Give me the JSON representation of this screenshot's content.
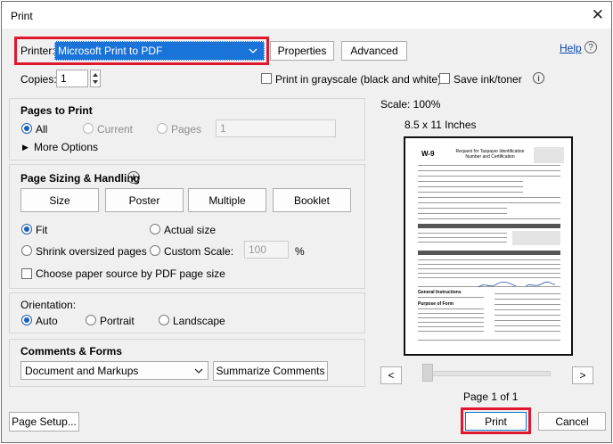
{
  "window": {
    "title": "Print",
    "close_glyph": "✕"
  },
  "printer": {
    "label": "Printer:",
    "selected": "Microsoft Print to PDF",
    "properties_button": "Properties",
    "advanced_button": "Advanced",
    "help_link": "Help",
    "help_icon": "?"
  },
  "copies": {
    "label": "Copies:",
    "value": "1",
    "grayscale_label": "Print in grayscale (black and white)",
    "save_ink_label": "Save ink/toner",
    "info_icon": "i"
  },
  "pages_to_print": {
    "title": "Pages to Print",
    "all_label": "All",
    "current_label": "Current",
    "pages_label": "Pages",
    "pages_value": "1",
    "more_options_label": "More Options"
  },
  "sizing": {
    "title": "Page Sizing & Handling",
    "info_icon": "i",
    "tabs": [
      "Size",
      "Poster",
      "Multiple",
      "Booklet"
    ],
    "fit_label": "Fit",
    "actual_size_label": "Actual size",
    "shrink_label": "Shrink oversized pages",
    "custom_scale_label": "Custom Scale:",
    "custom_scale_value": "100",
    "percent": "%",
    "paper_source_label": "Choose paper source by PDF page size"
  },
  "orientation": {
    "title": "Orientation:",
    "auto_label": "Auto",
    "portrait_label": "Portrait",
    "landscape_label": "Landscape"
  },
  "comments": {
    "title": "Comments & Forms",
    "selected": "Document and Markups",
    "summarize_button": "Summarize Comments"
  },
  "preview": {
    "scale_label": "Scale: 100%",
    "paper_label": "8.5 x 11 Inches",
    "doc_form_no": "W-9",
    "doc_title": "Request for Taxpayer Identification Number and Certification",
    "doc_general": "General Instructions",
    "doc_purpose": "Purpose of Form",
    "prev_glyph": "<",
    "next_glyph": ">",
    "page_indicator": "Page 1 of 1"
  },
  "footer": {
    "page_setup_button": "Page Setup...",
    "print_button": "Print",
    "cancel_button": "Cancel"
  },
  "colors": {
    "highlight_red": "#e0182d",
    "selection_blue": "#1a73d9",
    "radio_blue": "#1b5fb6",
    "link_blue": "#0645ad"
  }
}
